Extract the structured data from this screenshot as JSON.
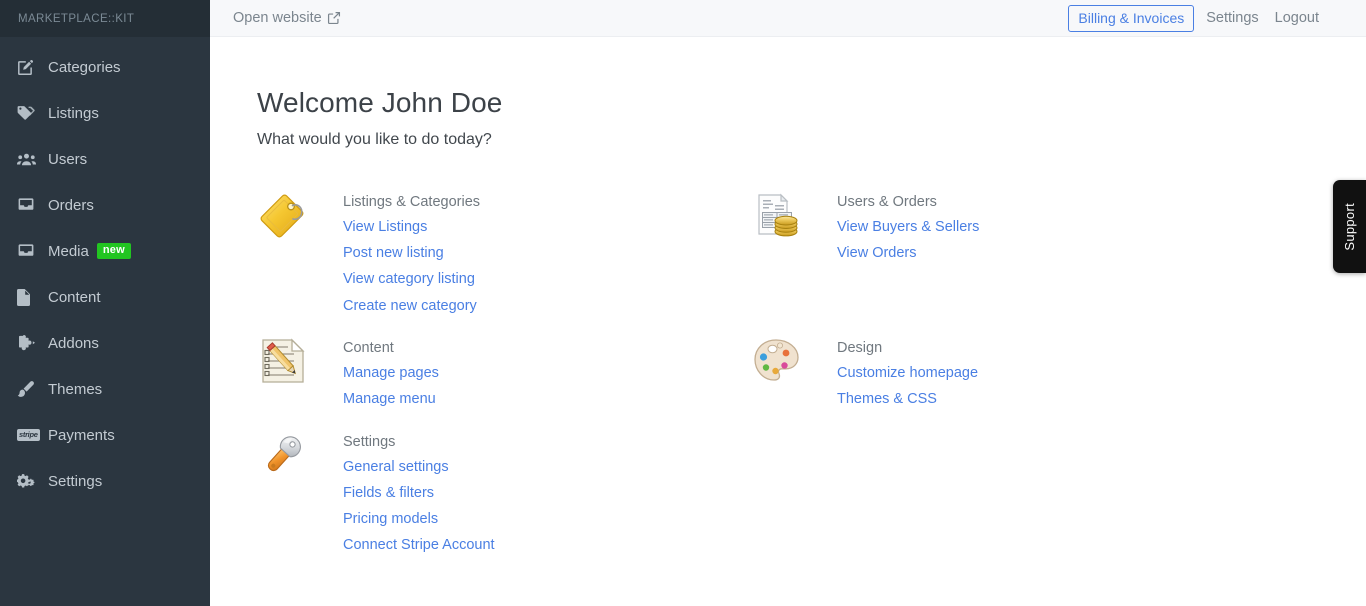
{
  "sidebar": {
    "brand": "MARKETPLACE::KIT",
    "items": [
      {
        "label": "Categories",
        "icon": "edit-square-icon",
        "badge": null
      },
      {
        "label": "Listings",
        "icon": "tag-icon",
        "badge": null
      },
      {
        "label": "Users",
        "icon": "users-icon",
        "badge": null
      },
      {
        "label": "Orders",
        "icon": "inbox-icon",
        "badge": null
      },
      {
        "label": "Media",
        "icon": "inbox-icon",
        "badge": "new"
      },
      {
        "label": "Content",
        "icon": "file-icon",
        "badge": null
      },
      {
        "label": "Addons",
        "icon": "puzzle-icon",
        "badge": null
      },
      {
        "label": "Themes",
        "icon": "paintbrush-icon",
        "badge": null
      },
      {
        "label": "Payments",
        "icon": "stripe-icon",
        "badge": null
      },
      {
        "label": "Settings",
        "icon": "gears-icon",
        "badge": null
      }
    ]
  },
  "topbar": {
    "open_website": "Open website",
    "billing_invoices": "Billing & Invoices",
    "settings": "Settings",
    "logout": "Logout"
  },
  "main": {
    "title": "Welcome John Doe",
    "subtitle": "What would you like to do today?",
    "cards": [
      {
        "heading": "Listings & Categories",
        "icon": "label-tag-icon",
        "links": [
          "View Listings",
          "Post new listing",
          "View category listing",
          "Create new category"
        ]
      },
      {
        "heading": "Users & Orders",
        "icon": "invoice-coins-icon",
        "links": [
          "View Buyers & Sellers",
          "View Orders"
        ]
      },
      {
        "heading": "Content",
        "icon": "memo-pencil-icon",
        "links": [
          "Manage pages",
          "Manage menu"
        ]
      },
      {
        "heading": "Design",
        "icon": "artist-palette-icon",
        "links": [
          "Customize homepage",
          "Themes & CSS"
        ]
      },
      {
        "heading": "Settings",
        "icon": "wrench-icon",
        "links": [
          "General settings",
          "Fields & filters",
          "Pricing models",
          "Connect Stripe Account"
        ]
      }
    ]
  },
  "support": {
    "label": "Support"
  },
  "colors": {
    "sidebar_bg": "#2b3640",
    "sidebar_brand_bg": "#242e36",
    "link_blue": "#4a7fe3",
    "badge_green": "#22c521",
    "topbar_bg": "#f7f8fa",
    "heading_gray": "#70787f",
    "support_bg": "#111111"
  }
}
